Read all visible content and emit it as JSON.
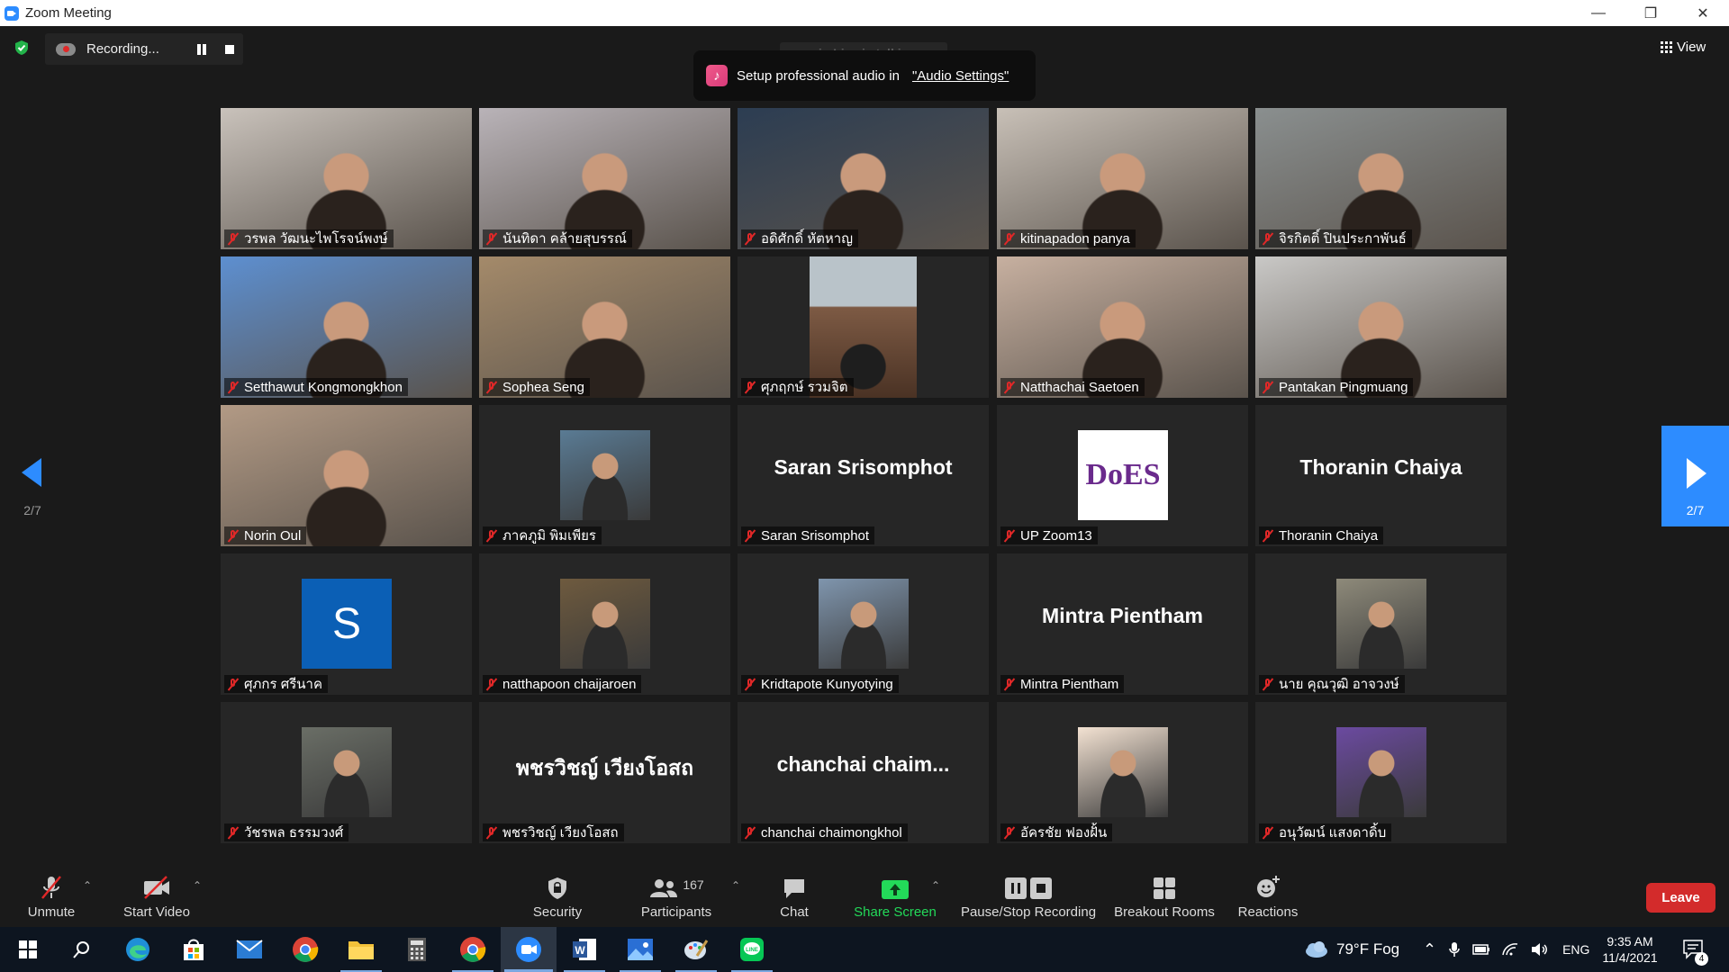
{
  "window": {
    "title": "Zoom Meeting"
  },
  "window_controls": {
    "minimize": "—",
    "restore": "❐",
    "close": "✕"
  },
  "recording": {
    "label": "Recording..."
  },
  "talking_indicator": "main Live is talking...",
  "audio_banner": {
    "text": "Setup professional audio in",
    "link": "\"Audio Settings\""
  },
  "view_button": "View",
  "pagination": {
    "prev": "2/7",
    "next": "2/7"
  },
  "participants": [
    {
      "name": "วรพล วัฒนะไพโรจน์พงษ์",
      "type": "video",
      "bg": "#c9c2bb"
    },
    {
      "name": "นันทิดา คล้ายสุบรรณ์",
      "type": "video",
      "bg": "#b9b3b8"
    },
    {
      "name": "อดิศักดิ์ หัตหาญ",
      "type": "video",
      "bg": "#2c3d52"
    },
    {
      "name": "kitinapadon panya",
      "type": "video",
      "bg": "#c8c0b7"
    },
    {
      "name": "จิรกิตติ์ ปินประกาพันธ์",
      "type": "video",
      "bg": "#8a8f8f"
    },
    {
      "name": "Setthawut Kongmongkhon",
      "type": "video",
      "bg": "#5d8fd0"
    },
    {
      "name": "Sophea Seng",
      "type": "video",
      "bg": "#a48a6a"
    },
    {
      "name": "ศุภฤกษ์ รวมจิต",
      "type": "video-narrow",
      "bg": "#7d5a44"
    },
    {
      "name": "Natthachai Saetoen",
      "type": "video",
      "bg": "#c7b0a0"
    },
    {
      "name": "Pantakan Pingmuang",
      "type": "video",
      "bg": "#c9c8c6"
    },
    {
      "name": "Norin Oul",
      "type": "video",
      "bg": "#b29a85"
    },
    {
      "name": "ภาคภูมิ พิมเพียร",
      "type": "avatar",
      "bg": "#5a7b94"
    },
    {
      "name": "Saran Srisomphot",
      "type": "name",
      "big": "Saran Srisomphot"
    },
    {
      "name": "UP Zoom13",
      "type": "logo",
      "logo": "DoES"
    },
    {
      "name": "Thoranin Chaiya",
      "type": "name",
      "big": "Thoranin Chaiya"
    },
    {
      "name": "ศุภกร ศรีนาค",
      "type": "letter",
      "letter": "S"
    },
    {
      "name": "natthapoon chaijaroen",
      "type": "avatar",
      "bg": "#6e5a3e"
    },
    {
      "name": "Kridtapote Kunyotying",
      "type": "avatar",
      "bg": "#7f95ad"
    },
    {
      "name": "Mintra Pientham",
      "type": "name",
      "big": "Mintra Pientham"
    },
    {
      "name": "นาย คุณวุฒิ อาจวงษ์",
      "type": "avatar",
      "bg": "#8e8a7a"
    },
    {
      "name": "วัชรพล ธรรมวงศ์",
      "type": "avatar",
      "bg": "#6a6e66"
    },
    {
      "name": "พชรวิชญ์ เวียงโอสถ",
      "type": "name",
      "big": "พชรวิชญ์ เวียงโอสถ"
    },
    {
      "name": "chanchai chaimongkhol",
      "type": "name",
      "big": "chanchai chaim..."
    },
    {
      "name": "อัครชัย ฟองฝั้น",
      "type": "avatar",
      "bg": "#f3e2d2"
    },
    {
      "name": "อนุวัฒน์ แสงดาดิ้บ",
      "type": "avatar",
      "bg": "#6b4aa0"
    }
  ],
  "toolbar": {
    "unmute": "Unmute",
    "start_video": "Start Video",
    "security": "Security",
    "participants": "Participants",
    "participants_count": "167",
    "chat": "Chat",
    "share_screen": "Share Screen",
    "pause_stop_recording": "Pause/Stop Recording",
    "breakout_rooms": "Breakout Rooms",
    "reactions": "Reactions",
    "leave": "Leave"
  },
  "taskbar": {
    "weather": "79°F Fog",
    "language": "ENG",
    "time": "9:35 AM",
    "date": "11/4/2021",
    "notification_count": "4"
  },
  "colors": {
    "accent": "#2d8cff",
    "muted": "#e02828",
    "share_green": "#23d959",
    "leave": "#d32b2b"
  }
}
